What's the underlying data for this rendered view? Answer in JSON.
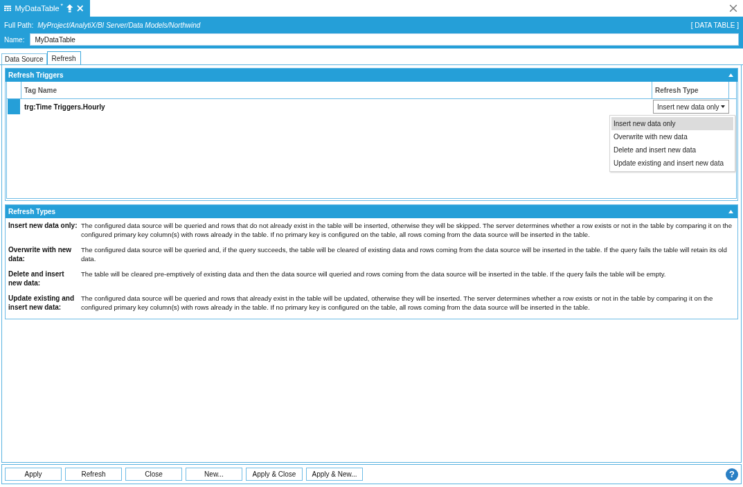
{
  "document_tab": {
    "title": "MyDataTable",
    "modified_mark": "*"
  },
  "header": {
    "path_label": "Full Path:",
    "path": "MyProject/AnalytiX/BI Server/Data Models/Northwind",
    "type_label": "[ DATA TABLE ]",
    "name_label": "Name:",
    "name_value": "MyDataTable"
  },
  "tabs": [
    {
      "label": "Data Source",
      "selected": false
    },
    {
      "label": "Refresh",
      "selected": true
    }
  ],
  "triggers": {
    "title": "Refresh Triggers",
    "expanded": true,
    "columns": [
      "Tag Name",
      "Refresh Type"
    ],
    "rows": [
      {
        "tag": "trg:Time Triggers.Hourly",
        "refresh_type": "Insert new data only",
        "selected": true
      }
    ],
    "dropdown": [
      {
        "label": "Insert new data only",
        "selected": true
      },
      {
        "label": "Overwrite with new data",
        "selected": false
      },
      {
        "label": "Delete and insert new data",
        "selected": false
      },
      {
        "label": "Update existing and insert new data",
        "selected": false
      }
    ]
  },
  "types": {
    "title": "Refresh Types",
    "expanded": true,
    "items": [
      {
        "term": "Insert new data only:",
        "description": "The configured data source will be queried and rows that do not already exist in the table will be inserted, otherwise they will be skipped. The server determines whether a row exists or not in the table by comparing it on the configured primary key column(s) with rows already in the table. If no primary key is configured on the table, all rows coming from the data source will be inserted in the table."
      },
      {
        "term": "Overwrite with new data:",
        "description": "The configured data source will be queried and, if the query succeeds, the table will be cleared of existing data and rows coming from the data source will be inserted in the table. If the query fails the table will retain its old data."
      },
      {
        "term": "Delete and insert new data:",
        "description": "The table will be cleared pre-emptively of existing data and then the data source will queried and rows coming from the data source will be inserted in the table. If the query fails the table will be empty."
      },
      {
        "term": "Update existing and insert new data:",
        "description": "The configured data source will be queried and rows that already exist in the table will be updated, otherwise they will be inserted. The server determines whether a row exists or not in the table by comparing it on the configured primary key column(s) with rows already in the table. If no primary key is configured on the table, all rows coming from the data source will be inserted in the table."
      }
    ]
  },
  "buttons": [
    "Apply",
    "Refresh",
    "Close",
    "New...",
    "Apply & Close",
    "Apply & New..."
  ],
  "help_glyph": "?"
}
